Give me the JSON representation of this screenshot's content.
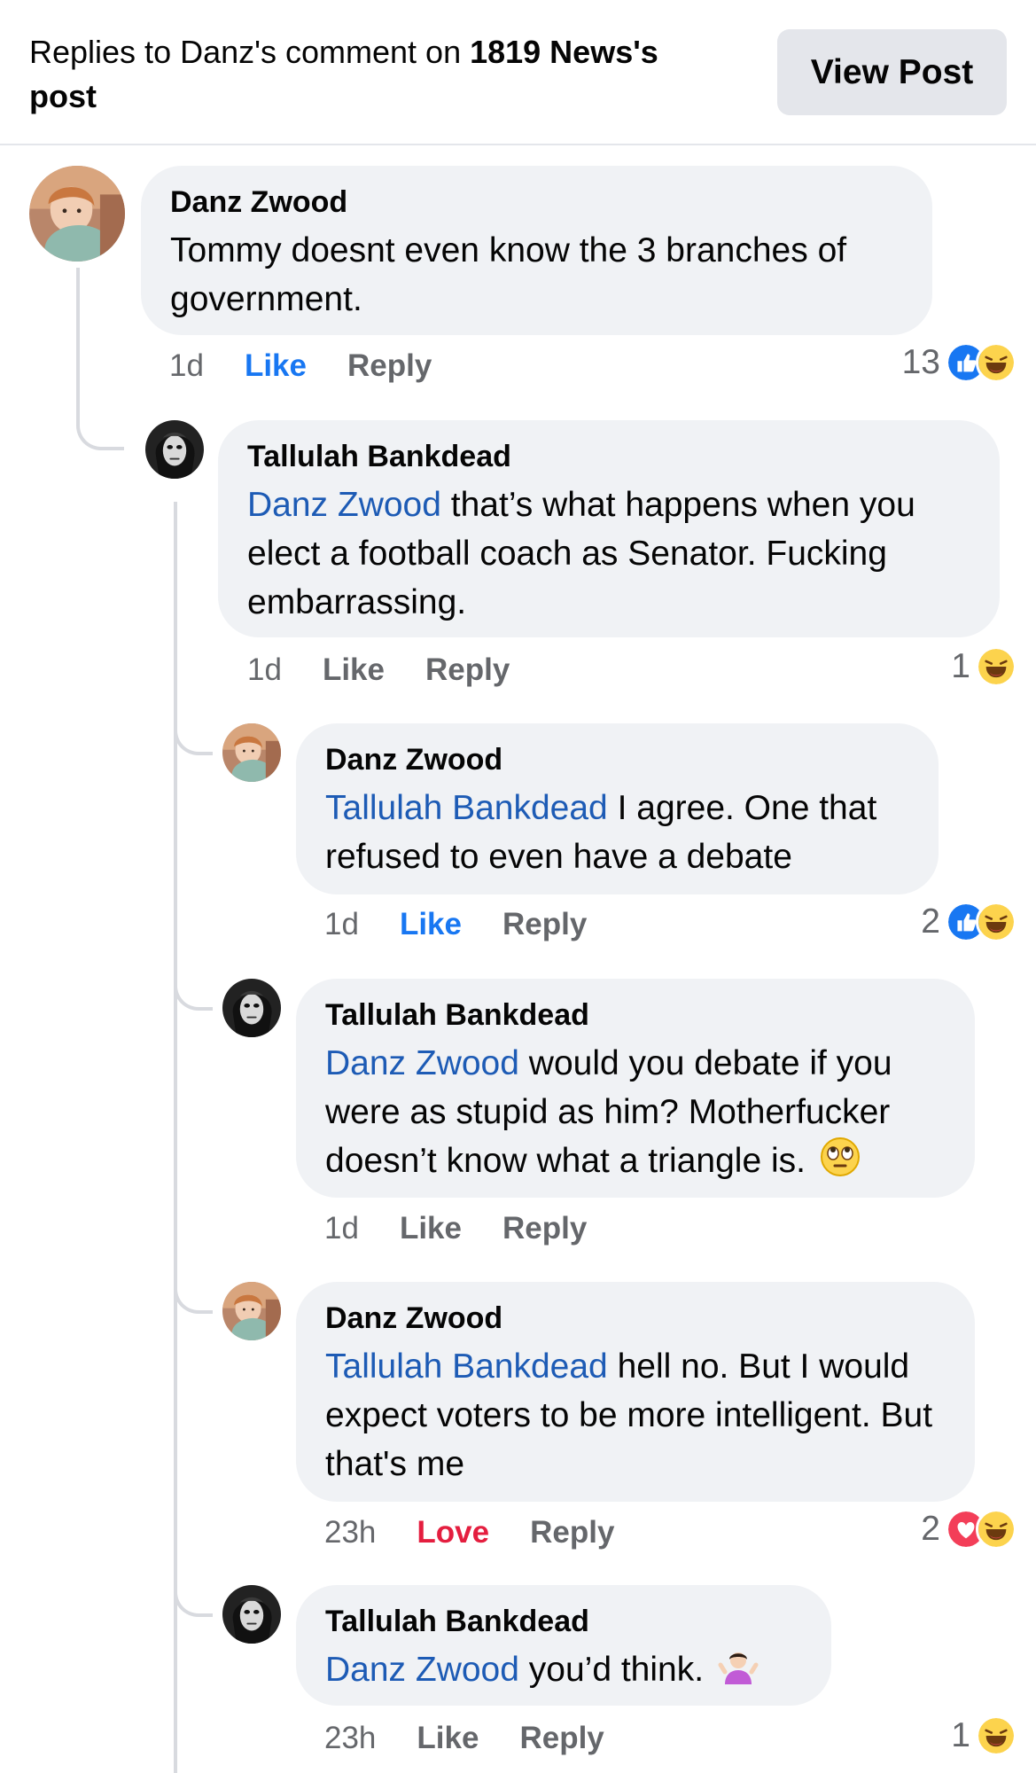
{
  "header": {
    "prefix": "Replies to Danz's comment on ",
    "page": "1819 News",
    "suffix": "'s",
    "last_line": "post",
    "view_post_label": "View Post"
  },
  "comments": [
    {
      "author": "Danz Zwood",
      "mention": "",
      "text": "Tommy doesnt even know the 3 branches of government.",
      "time": "1d",
      "reaction_label": "Like",
      "reaction_state": "liked",
      "reply_label": "Reply",
      "reaction_count": "13",
      "reaction_icons": [
        "like-icon",
        "haha-icon"
      ]
    },
    {
      "author": "Tallulah Bankdead",
      "mention": "Danz Zwood",
      "text": " that’s what happens when you elect a football coach as Senator.   Fucking embarrassing.",
      "time": "1d",
      "reaction_label": "Like",
      "reaction_state": "none",
      "reply_label": "Reply",
      "reaction_count": "1",
      "reaction_icons": [
        "haha-icon"
      ]
    },
    {
      "author": "Danz Zwood",
      "mention": "Tallulah Bankdead",
      "text": " I agree. One that refused to even have a debate",
      "time": "1d",
      "reaction_label": "Like",
      "reaction_state": "liked",
      "reply_label": "Reply",
      "reaction_count": "2",
      "reaction_icons": [
        "like-icon",
        "haha-icon"
      ]
    },
    {
      "author": "Tallulah Bankdead",
      "mention": "Danz Zwood",
      "text": " would you debate if you were as stupid as him?  Motherfucker doesn’t know what a triangle is.",
      "emoji": "eye-roll-emoji",
      "time": "1d",
      "reaction_label": "Like",
      "reaction_state": "none",
      "reply_label": "Reply",
      "reaction_count": "",
      "reaction_icons": []
    },
    {
      "author": "Danz Zwood",
      "mention": "Tallulah Bankdead",
      "text": " hell no. But I would expect voters to be more intelligent. But that's me",
      "time": "23h",
      "reaction_label": "Love",
      "reaction_state": "loved",
      "reply_label": "Reply",
      "reaction_count": "2",
      "reaction_icons": [
        "love-icon",
        "haha-icon"
      ]
    },
    {
      "author": "Tallulah Bankdead",
      "mention": "Danz Zwood",
      "text": " you’d think.",
      "emoji": "shrug-emoji",
      "time": "23h",
      "reaction_label": "Like",
      "reaction_state": "none",
      "reply_label": "Reply",
      "reaction_count": "1",
      "reaction_icons": [
        "haha-icon"
      ]
    }
  ],
  "colors": {
    "mention": "#1d5bb5",
    "like": "#1877f2",
    "love": "#e41e3f",
    "bubble": "#f0f2f5",
    "meta": "#65676b"
  }
}
